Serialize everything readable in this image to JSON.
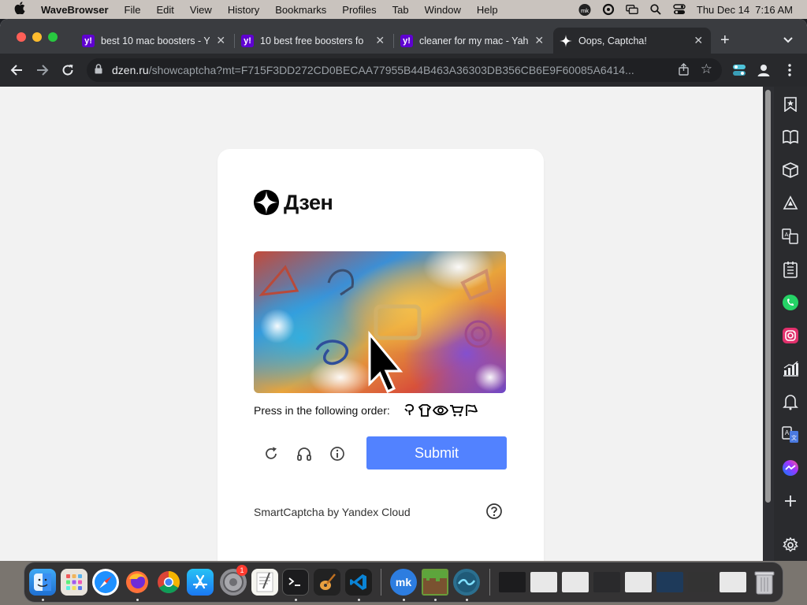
{
  "menubar": {
    "app_name": "WaveBrowser",
    "items": [
      "File",
      "Edit",
      "View",
      "History",
      "Bookmarks",
      "Profiles",
      "Tab",
      "Window",
      "Help"
    ],
    "clock": "Thu Dec 14  7:16 AM"
  },
  "tabs": [
    {
      "title": "best 10 mac boosters - Y",
      "favicon": "yahoo-icon",
      "active": false
    },
    {
      "title": "10 best free boosters fo",
      "favicon": "yahoo-icon",
      "active": false
    },
    {
      "title": "cleaner for my mac - Yah",
      "favicon": "yahoo-icon",
      "active": false
    },
    {
      "title": "Oops, Captcha!",
      "favicon": "dzen-icon",
      "active": true
    }
  ],
  "favicon_letter": "y!",
  "address": {
    "host": "dzen.ru",
    "path": "/showcaptcha?mt=F715F3DD272CD0BECAA77955B44B463A36303DB356CB6E9F60085A6414..."
  },
  "page": {
    "logo_text": "Дзен",
    "instruction": "Press in the following order:",
    "order_icons": [
      "balloon-icon",
      "shirt-icon",
      "eye-icon",
      "cart-icon",
      "flag-icon"
    ],
    "submit_label": "Submit",
    "footer": "SmartCaptcha by Yandex Cloud"
  },
  "colors": {
    "submit": "#5282ff",
    "tabstrip": "#3a3c40",
    "toolbar": "#28292c",
    "page_bg": "#f2f2f2"
  },
  "sidebar_icons": [
    "bookmark-star-icon",
    "reading-list-icon",
    "box-icon",
    "ai-icon",
    "translate-files-icon",
    "checklist-icon",
    "whatsapp-icon",
    "instagram-icon",
    "chart-icon",
    "bell-icon",
    "translate-icon",
    "messenger-icon",
    "plus-icon",
    "settings-icon"
  ],
  "dock": {
    "badge": "1",
    "apps": [
      "finder-icon",
      "launchpad-icon",
      "safari-icon",
      "firefox-icon",
      "chrome-icon",
      "app-store-icon",
      "system-settings-icon",
      "textedit-icon",
      "terminal-icon",
      "garageband-icon",
      "vscode-icon",
      "mk-app-icon",
      "minecraft-icon",
      "wave-browser-icon",
      "trash-icon"
    ]
  }
}
